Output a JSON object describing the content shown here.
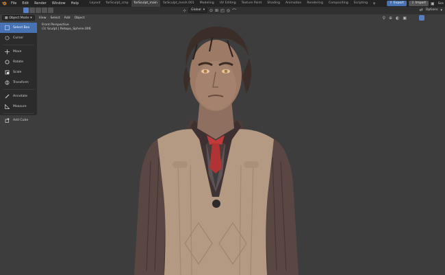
{
  "topbar": {
    "menus": [
      "File",
      "Edit",
      "Render",
      "Window",
      "Help"
    ],
    "workspaces": [
      {
        "label": "Layout",
        "active": false
      },
      {
        "label": "farSculpt_cmp",
        "active": false
      },
      {
        "label": "farSculpt_main",
        "active": true
      },
      {
        "label": "farSculpt_mesh.001",
        "active": false
      },
      {
        "label": "Modeling",
        "active": false
      },
      {
        "label": "UV Editing",
        "active": false
      },
      {
        "label": "Texture Paint",
        "active": false
      },
      {
        "label": "Shading",
        "active": false
      },
      {
        "label": "Animation",
        "active": false
      },
      {
        "label": "Rendering",
        "active": false
      },
      {
        "label": "Compositing",
        "active": false
      },
      {
        "label": "Scripting",
        "active": false
      }
    ],
    "export_label": "Export",
    "import_label": "Import",
    "scene_label": "Sce"
  },
  "header": {
    "orientation_label": "Global",
    "options_label": "Options"
  },
  "subheader": {
    "mode_label": "Object Mode",
    "menus": [
      "View",
      "Select",
      "Add",
      "Object"
    ]
  },
  "toolbar": {
    "tools": [
      {
        "label": "Select Box",
        "icon": "select-box-icon",
        "active": true
      },
      {
        "label": "Cursor",
        "icon": "cursor-icon",
        "active": false
      },
      {
        "label": "Move",
        "icon": "move-icon",
        "active": false
      },
      {
        "label": "Rotate",
        "icon": "rotate-icon",
        "active": false
      },
      {
        "label": "Scale",
        "icon": "scale-icon",
        "active": false
      },
      {
        "label": "Transform",
        "icon": "transform-icon",
        "active": false
      },
      {
        "label": "Annotate",
        "icon": "annotate-icon",
        "active": false
      },
      {
        "label": "Measure",
        "icon": "measure-icon",
        "active": false
      },
      {
        "label": "Add Cube",
        "icon": "add-cube-icon",
        "active": false
      }
    ]
  },
  "viewport": {
    "view_name": "Front Perspective",
    "object_info": "(1) Sculpt | Retopo_Sphere.006"
  },
  "colors": {
    "accent": "#4772b3",
    "background": "#3d3d3d"
  }
}
